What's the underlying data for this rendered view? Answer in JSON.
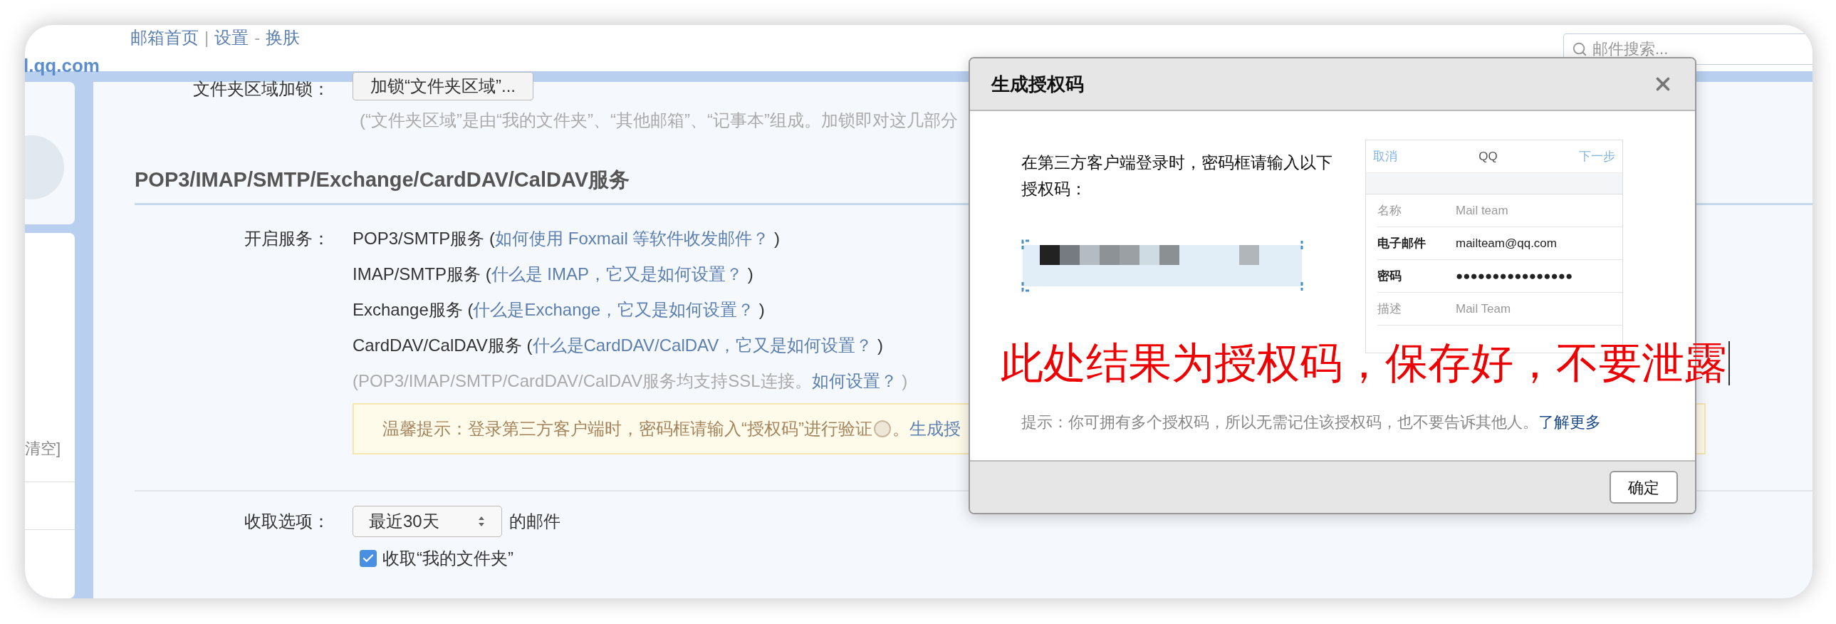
{
  "header": {
    "logo_text": "l.qq.com",
    "nav": [
      {
        "kind": "link",
        "label": "邮箱首页"
      },
      {
        "kind": "separator",
        "label": "|"
      },
      {
        "kind": "link",
        "label": "设置"
      },
      {
        "kind": "separator",
        "label": "-"
      },
      {
        "kind": "link",
        "label": "换肤"
      }
    ]
  },
  "search": {
    "placeholder": "邮件搜索..."
  },
  "sidebar": {
    "text": "清空]"
  },
  "folder_lock": {
    "label": "文件夹区域加锁：",
    "button": "加锁“文件夹区域”...",
    "note": "(“文件夹区域”是由“我的文件夹”、“其他邮箱”、“记事本”组成。加锁即对这几部分"
  },
  "section_title": "POP3/IMAP/SMTP/Exchange/CardDAV/CalDAV服务",
  "services": {
    "label": "开启服务：",
    "items": [
      {
        "name": "POP3/SMTP服务",
        "open": "(",
        "link": "如何使用 Foxmail 等软件收发邮件？",
        "close": ")"
      },
      {
        "name": "IMAP/SMTP服务",
        "open": "(",
        "link": "什么是 IMAP，它又是如何设置？",
        "close": ")"
      },
      {
        "name": "Exchange服务",
        "open": "(",
        "link": "什么是Exchange，它又是如何设置？",
        "close": ")"
      },
      {
        "name": "CardDAV/CalDAV服务",
        "open": "(",
        "link": "什么是CardDAV/CalDAV，它又是如何设置？",
        "close": ")"
      }
    ],
    "ssl_note": {
      "text": "(POP3/IMAP/SMTP/CardDAV/CalDAV服务均支持SSL连接。",
      "link": "如何设置？",
      "close": ")"
    }
  },
  "tip": {
    "text": "温馨提示：登录第三方客户端时，密码框请输入“授权码”进行验证",
    "after": "。",
    "link": "生成授"
  },
  "receive": {
    "label": "收取选项：",
    "select": "最近30天",
    "suffix": "的邮件",
    "checkbox": {
      "label": "收取“我的文件夹”",
      "checked": true
    }
  },
  "dialog": {
    "title": "生成授权码",
    "message": "在第三方客户端登录时，密码框请输入以下授权码：",
    "hint": "提示：你可拥有多个授权码，所以无需记住该授权码，也不要告诉其他人。",
    "hint_link": "了解更多",
    "ok": "确定",
    "preview": {
      "cancel": "取消",
      "title": "QQ",
      "next": "下一步",
      "rows": [
        {
          "label": "名称",
          "value": "Mail team",
          "kind": "muted"
        },
        {
          "label": "电子邮件",
          "value": "mailteam@qq.com",
          "kind": "strong"
        },
        {
          "label": "密码",
          "value": "●●●●●●●●●●●●●●●●",
          "kind": "strong"
        },
        {
          "label": "描述",
          "value": "Mail Team",
          "kind": "muted"
        }
      ]
    }
  },
  "annotation": {
    "text": "此处结果为授权码，保存好，不要泄露"
  }
}
